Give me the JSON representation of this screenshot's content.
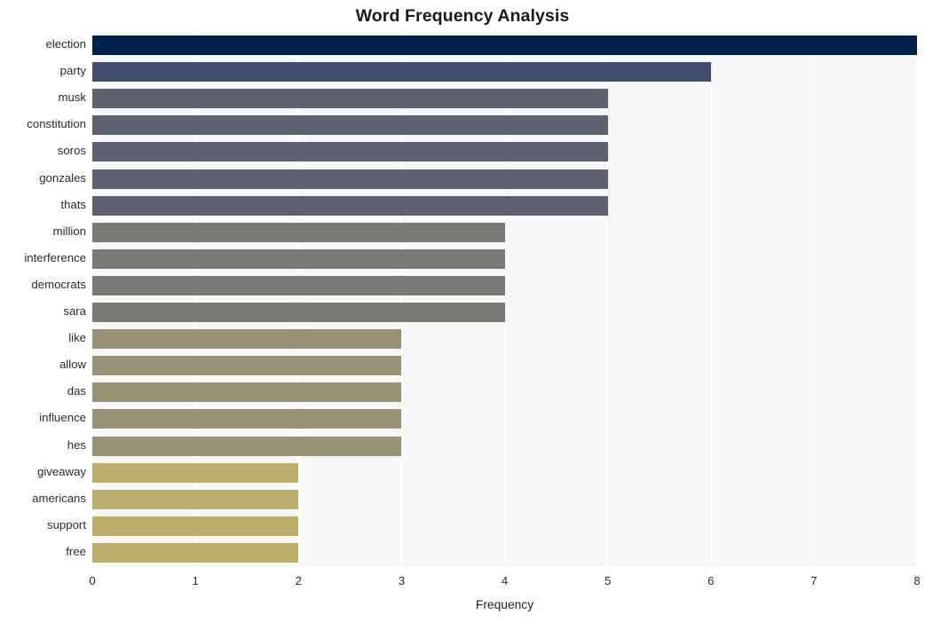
{
  "chart_data": {
    "type": "bar",
    "orientation": "horizontal",
    "title": "Word Frequency Analysis",
    "xlabel": "Frequency",
    "ylabel": "",
    "xlim": [
      0,
      8
    ],
    "xticks": [
      "0",
      "1",
      "2",
      "3",
      "4",
      "5",
      "6",
      "7",
      "8"
    ],
    "grid": "vertical-only",
    "legend": "none",
    "categories": [
      "election",
      "party",
      "musk",
      "constitution",
      "soros",
      "gonzales",
      "thats",
      "million",
      "interference",
      "democrats",
      "sara",
      "like",
      "allow",
      "das",
      "influence",
      "hes",
      "giveaway",
      "americans",
      "support",
      "free"
    ],
    "values": [
      8,
      6,
      5,
      5,
      5,
      5,
      5,
      4,
      4,
      4,
      4,
      3,
      3,
      3,
      3,
      3,
      2,
      2,
      2,
      2
    ],
    "bar_colors": [
      "#012349",
      "#434f6e",
      "#5d6170",
      "#5d6170",
      "#5d6170",
      "#5d6170",
      "#5d6170",
      "#7b7a76",
      "#7b7a76",
      "#7b7a76",
      "#7b7a76",
      "#999278",
      "#999278",
      "#999278",
      "#999278",
      "#999278",
      "#bcae6d",
      "#bcae6d",
      "#bcae6d",
      "#bcae6d"
    ]
  },
  "style": {
    "plot_background": "#f7f7f7",
    "figure_background": "#ffffff",
    "gridline_color": "#ffffff",
    "text_color": "#2b2b2b"
  }
}
